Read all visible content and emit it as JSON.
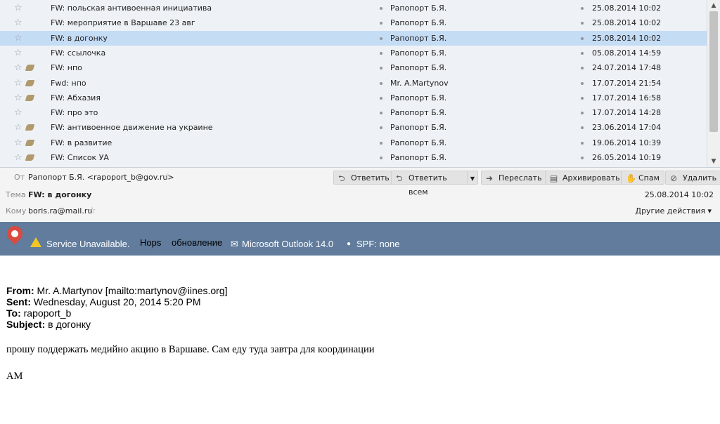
{
  "message_list": [
    {
      "subject": "FW: польская антивоенная инициатива",
      "from": "Рапопорт Б.Я.",
      "date": "25.08.2014 10:02",
      "tag": false,
      "selected": false
    },
    {
      "subject": "FW: мероприятие в Варшаве 23 авг",
      "from": "Рапопорт Б.Я.",
      "date": "25.08.2014 10:02",
      "tag": false,
      "selected": false
    },
    {
      "subject": "FW: в догонку",
      "from": "Рапопорт Б.Я.",
      "date": "25.08.2014 10:02",
      "tag": false,
      "selected": true
    },
    {
      "subject": "FW: ссылочка",
      "from": "Рапопорт Б.Я.",
      "date": "05.08.2014 14:59",
      "tag": false,
      "selected": false
    },
    {
      "subject": "FW: нпо",
      "from": "Рапопорт Б.Я.",
      "date": "24.07.2014 17:48",
      "tag": true,
      "selected": false
    },
    {
      "subject": "Fwd: нпо",
      "from": "Mr. A.Martynov",
      "date": "17.07.2014 21:54",
      "tag": true,
      "selected": false
    },
    {
      "subject": "FW: Абхазия",
      "from": "Рапопорт Б.Я.",
      "date": "17.07.2014 16:58",
      "tag": true,
      "selected": false
    },
    {
      "subject": "FW: про это",
      "from": "Рапопорт Б.Я.",
      "date": "17.07.2014 14:28",
      "tag": false,
      "selected": false
    },
    {
      "subject": "FW: антивоенное движение на украине",
      "from": "Рапопорт Б.Я.",
      "date": "23.06.2014 17:04",
      "tag": true,
      "selected": false
    },
    {
      "subject": "FW: в развитие",
      "from": "Рапопорт Б.Я.",
      "date": "19.06.2014 10:39",
      "tag": true,
      "selected": false
    },
    {
      "subject": "FW: Список УА",
      "from": "Рапопорт Б.Я.",
      "date": "26.05.2014 10:19",
      "tag": true,
      "selected": false
    }
  ],
  "header": {
    "from_label": "От",
    "from_value": "Рапопорт Б.Я. <rapoport_b@gov.ru>",
    "subject_label": "Тема",
    "subject_value": "FW: в догонку",
    "to_label": "Кому",
    "to_value": "boris.ra@mail.ru",
    "date": "25.08.2014 10:02",
    "other_actions": "Другие действия ▾"
  },
  "toolbar": {
    "reply": "Ответить",
    "reply_all": "Ответить всем",
    "forward": "Переслать",
    "archive": "Архивировать",
    "spam": "Спам",
    "delete": "Удалить"
  },
  "banner": {
    "service": "Service Unavailable.",
    "hops": "Hops",
    "update": "обновление",
    "mailer": "Microsoft Outlook 14.0",
    "spf": "SPF: none",
    "bg_color": "#617c9c"
  },
  "body": {
    "from_label": "From:",
    "from_value": " Mr. A.Martynov [mailto:martynov@iines.org]",
    "sent_label": "Sent:",
    "sent_value": " Wednesday, August 20, 2014 5:20 PM",
    "to_label": "To:",
    "to_value": " rapoport_b",
    "subject_label": "Subject:",
    "subject_value": " в догонку",
    "text": "прошу поддержать медийно акцию в Варшаве. Сам еду туда завтра для координации",
    "signature": "АМ"
  }
}
